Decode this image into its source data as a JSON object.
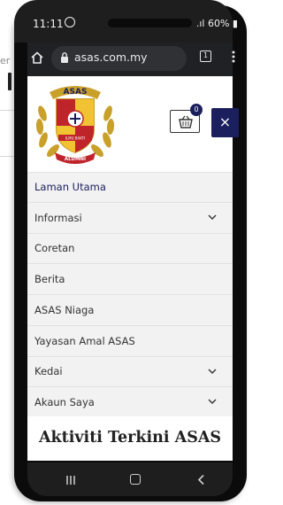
{
  "background": {
    "partial_text": "er"
  },
  "status_bar": {
    "time": "11:11",
    "battery": "60%"
  },
  "browser": {
    "url": "asas.com.my",
    "tab_count": "1"
  },
  "site": {
    "logo_text": {
      "top": "ASAS",
      "ribbon": "ALUMNI",
      "motto": "ILMU BAKTI"
    },
    "cart_count": "0",
    "close_label": "×",
    "menu": [
      {
        "label": "Laman Utama",
        "has_submenu": false,
        "active": true
      },
      {
        "label": "Informasi",
        "has_submenu": true
      },
      {
        "label": "Coretan",
        "has_submenu": false
      },
      {
        "label": "Berita",
        "has_submenu": false
      },
      {
        "label": "ASAS Niaga",
        "has_submenu": false
      },
      {
        "label": "Yayasan Amal ASAS",
        "has_submenu": false
      },
      {
        "label": "Kedai",
        "has_submenu": true
      },
      {
        "label": "Akaun Saya",
        "has_submenu": true
      }
    ],
    "heading": "Aktiviti Terkini ASAS"
  },
  "colors": {
    "brand_navy": "#1b1f5e",
    "menu_bg": "#f2f2f2",
    "browser_bar": "#202124"
  },
  "icons": {
    "home": "home-icon",
    "lock": "lock-icon",
    "tabs": "tabs-icon",
    "menu": "more-vert-icon",
    "cart": "cart-icon",
    "close": "close-icon",
    "chevron": "chevron-down-icon",
    "nav_recent": "recent-apps-icon",
    "nav_home": "home-nav-icon",
    "nav_back": "back-icon"
  }
}
